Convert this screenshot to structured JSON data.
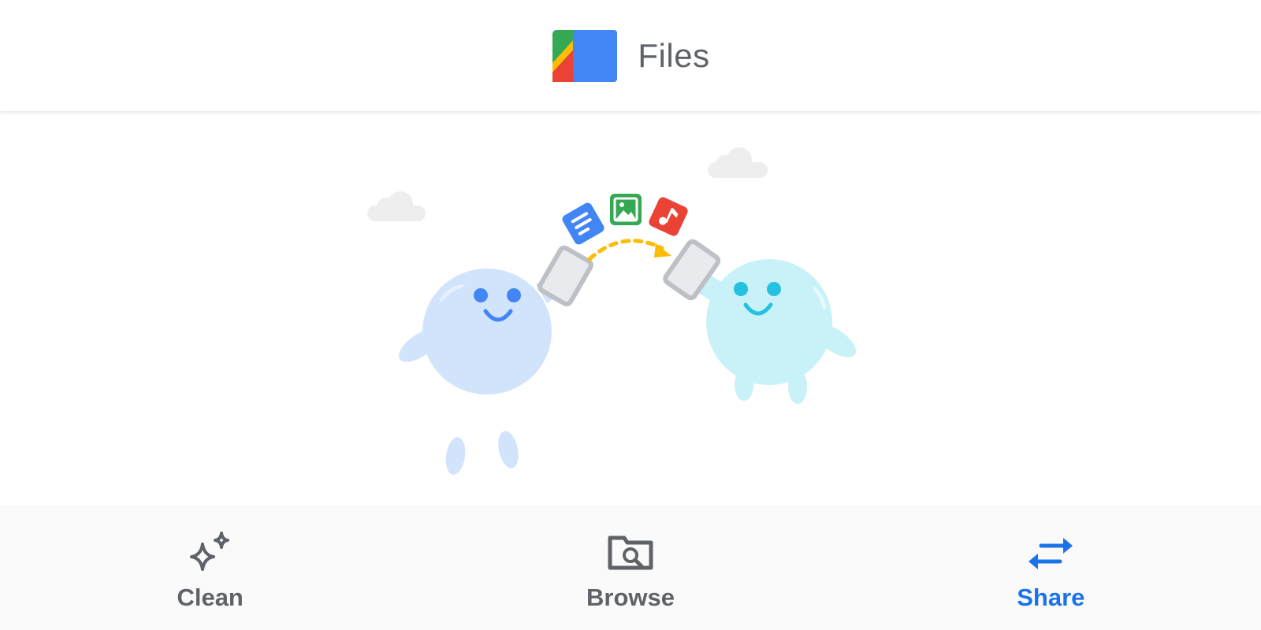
{
  "app_bar": {
    "title": "Files",
    "logo_icon": "files-logo-icon"
  },
  "illustration": {
    "description_icons": [
      "document-icon",
      "image-icon",
      "music-icon"
    ],
    "colors": {
      "left_character": "#d2e3fc",
      "right_character": "#c9f1f8",
      "arrow": "#fbbc04",
      "document": "#4285f4",
      "image": "#34a853",
      "music": "#ea4335"
    }
  },
  "bottom_nav": {
    "active_color": "#1a73e8",
    "inactive_color": "#5f6368",
    "items": [
      {
        "label": "Clean",
        "icon": "sparkle-icon",
        "active": false
      },
      {
        "label": "Browse",
        "icon": "folder-search-icon",
        "active": false
      },
      {
        "label": "Share",
        "icon": "swap-arrows-icon",
        "active": true
      }
    ]
  }
}
